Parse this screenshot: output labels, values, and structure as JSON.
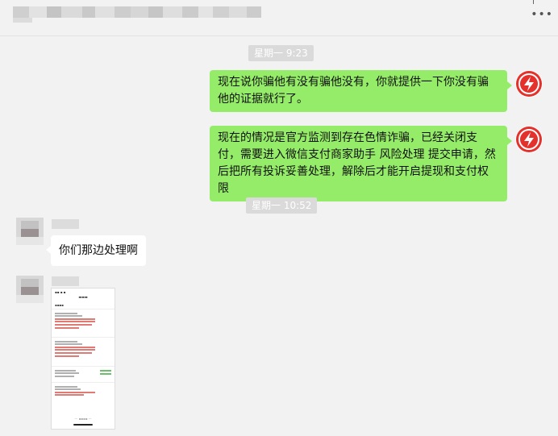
{
  "header": {
    "title_redacted": true,
    "more_icon": "more-icon"
  },
  "messages": {
    "time1": "星期一 9:23",
    "msg1": "现在说你骗他有没有骗他没有，你就提供一下你没有骗他的证据就行了。",
    "msg2": "现在的情况是官方监测到存在色情诈骗，已经关闭支付，需要进入微信支付商家助手 风险处理 提交申请，然后把所有投诉妥善处理，解除后才能开启提现和支付权限",
    "time2": "星期一 10:52",
    "msg3": "你们那边处理啊"
  },
  "shared_screenshot": {
    "type": "image",
    "content": "complaint-records-screenshot"
  },
  "colors": {
    "self_bubble": "#95ec69",
    "other_bubble": "#ffffff",
    "background": "#f2f2f2",
    "brand_avatar": "#e5312b"
  }
}
